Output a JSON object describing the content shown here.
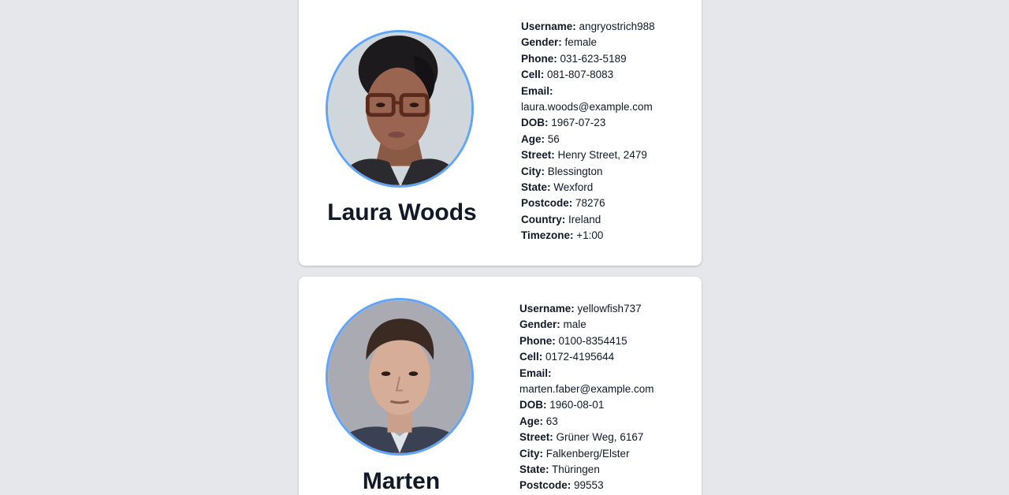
{
  "profiles": [
    {
      "name": "Laura Woods",
      "avatar_icon": "person-portrait-female-glasses",
      "fields": {
        "username": {
          "label": "Username:",
          "value": "angryostrich988"
        },
        "gender": {
          "label": "Gender:",
          "value": "female"
        },
        "phone": {
          "label": "Phone:",
          "value": "031-623-5189"
        },
        "cell": {
          "label": "Cell:",
          "value": "081-807-8083"
        },
        "email": {
          "label": "Email:",
          "value": "laura.woods@example.com"
        },
        "dob": {
          "label": "DOB:",
          "value": "1967-07-23"
        },
        "age": {
          "label": "Age:",
          "value": "56"
        },
        "street": {
          "label": "Street:",
          "value": "Henry Street, 2479"
        },
        "city": {
          "label": "City:",
          "value": "Blessington"
        },
        "state": {
          "label": "State:",
          "value": "Wexford"
        },
        "postcode": {
          "label": "Postcode:",
          "value": "78276"
        },
        "country": {
          "label": "Country:",
          "value": "Ireland"
        },
        "timezone": {
          "label": "Timezone:",
          "value": "+1:00"
        }
      }
    },
    {
      "name": "Marten",
      "avatar_icon": "person-portrait-male-suit",
      "fields": {
        "username": {
          "label": "Username:",
          "value": "yellowfish737"
        },
        "gender": {
          "label": "Gender:",
          "value": "male"
        },
        "phone": {
          "label": "Phone:",
          "value": "0100-8354415"
        },
        "cell": {
          "label": "Cell:",
          "value": "0172-4195644"
        },
        "email": {
          "label": "Email:",
          "value": "marten.faber@example.com"
        },
        "dob": {
          "label": "DOB:",
          "value": "1960-08-01"
        },
        "age": {
          "label": "Age:",
          "value": "63"
        },
        "street": {
          "label": "Street:",
          "value": "Grüner Weg, 6167"
        },
        "city": {
          "label": "City:",
          "value": "Falkenberg/Elster"
        },
        "state": {
          "label": "State:",
          "value": "Thüringen"
        },
        "postcode": {
          "label": "Postcode:",
          "value": "99553"
        }
      }
    }
  ],
  "colors": {
    "page_background": "#e5e7eb",
    "card_background": "#ffffff",
    "avatar_border": "#60a5fa"
  }
}
